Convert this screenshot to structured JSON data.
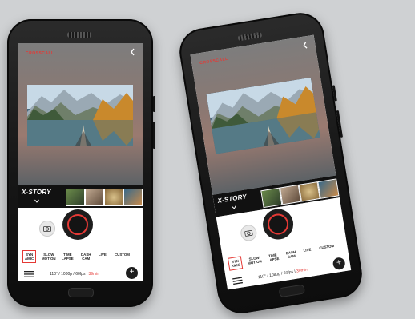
{
  "colors": {
    "accent": "#e53935",
    "background": "#cfd1d3",
    "phone_body": "#161616",
    "strip": "#111111"
  },
  "camera_app": {
    "brand": "CROSSCALL",
    "strip_title": "X-STORY",
    "modes": [
      {
        "label": "SYN\nAMIC",
        "active": true
      },
      {
        "label": "SLOW\nMOTION",
        "active": false
      },
      {
        "label": "TIME\nLAPSE",
        "active": false
      },
      {
        "label": "DASH\nCAM",
        "active": false
      },
      {
        "label": "LIVE",
        "active": false
      },
      {
        "label": "CUSTOM",
        "active": false
      }
    ],
    "status_prefix": "110° / 1080p / 60fps | ",
    "status_duration": "39min",
    "add_label": "+"
  },
  "icons": [
    "back-chevron-icon",
    "camera-icon",
    "menu-icon",
    "chevron-down-icon",
    "plus-icon"
  ]
}
